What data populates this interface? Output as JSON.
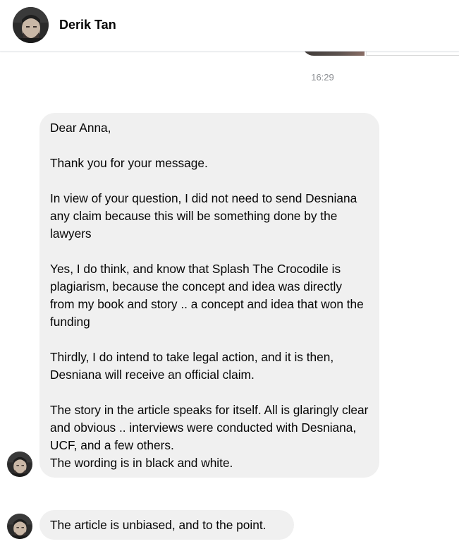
{
  "header": {
    "contact_name": "Derik Tan",
    "avatar_icon": "profile-photo-icon"
  },
  "thread": {
    "timestamp": "16:29",
    "messages": [
      {
        "paragraphs": [
          "Dear Anna,",
          "Thank you for your message.",
          "In view of your question, I did not need to send Desniana any claim because this will be something done by the lawyers",
          "Yes, I do think, and know that Splash The Crocodile is plagiarism, because the concept and idea was directly from my book and story .. a concept and idea that won the funding",
          "Thirdly, I do intend to take legal action, and it is then, Desniana will receive an official claim.",
          "The story in the article speaks for itself. All is glaringly clear and obvious .. interviews were conducted with Desniana, UCF, and a few others.",
          "The wording is in black and white."
        ]
      },
      {
        "paragraphs": [
          "The article is unbiased, and to the point."
        ]
      }
    ]
  },
  "colors": {
    "bubble_bg": "#f0f0f0",
    "text": "#050505",
    "timestamp": "#8a8d91",
    "header_border": "#e4e6eb"
  }
}
